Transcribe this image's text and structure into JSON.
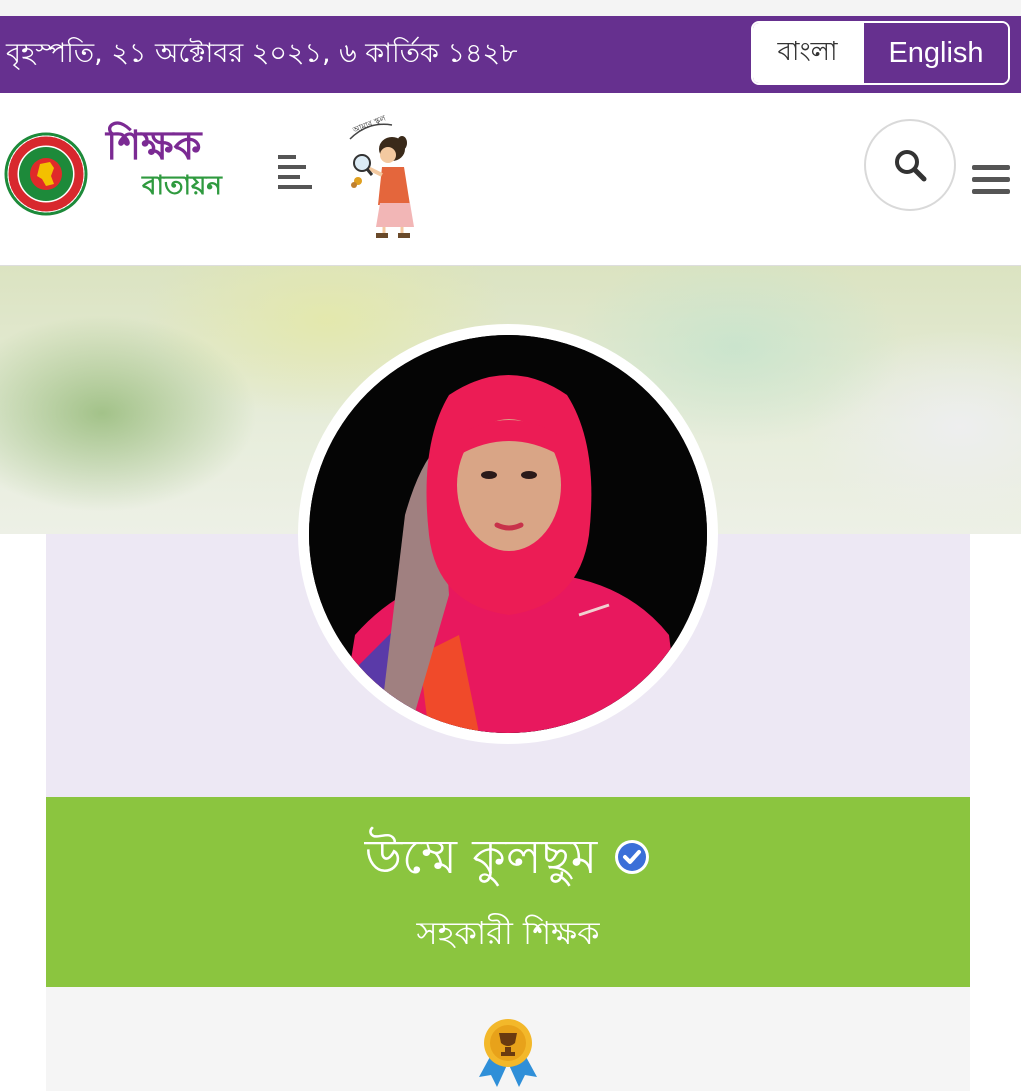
{
  "topbar": {
    "date": "বৃহস্পতি, ২১ অক্টোবর ২০২১, ৬ কার্তিক ১৪২৮",
    "lang_bangla": "বাংলা",
    "lang_english": "English",
    "background_color": "#66308f"
  },
  "header": {
    "brand_line1": "শিক্ষক",
    "brand_line2": "বাতায়ন",
    "brand_colors": {
      "primary": "#7b2a93",
      "secondary": "#2f9a3f"
    },
    "icons": [
      "government-seal-icon",
      "align-left-icon",
      "mascot-illustration",
      "search-icon",
      "hamburger-menu-icon"
    ]
  },
  "profile": {
    "name": "উম্মে কুলছুম",
    "role": "সহকারী শিক্ষক",
    "verified": true,
    "band_color": "#8bc53f",
    "card_color": "#ede8f4",
    "badge_icon": "award-medal-icon"
  }
}
